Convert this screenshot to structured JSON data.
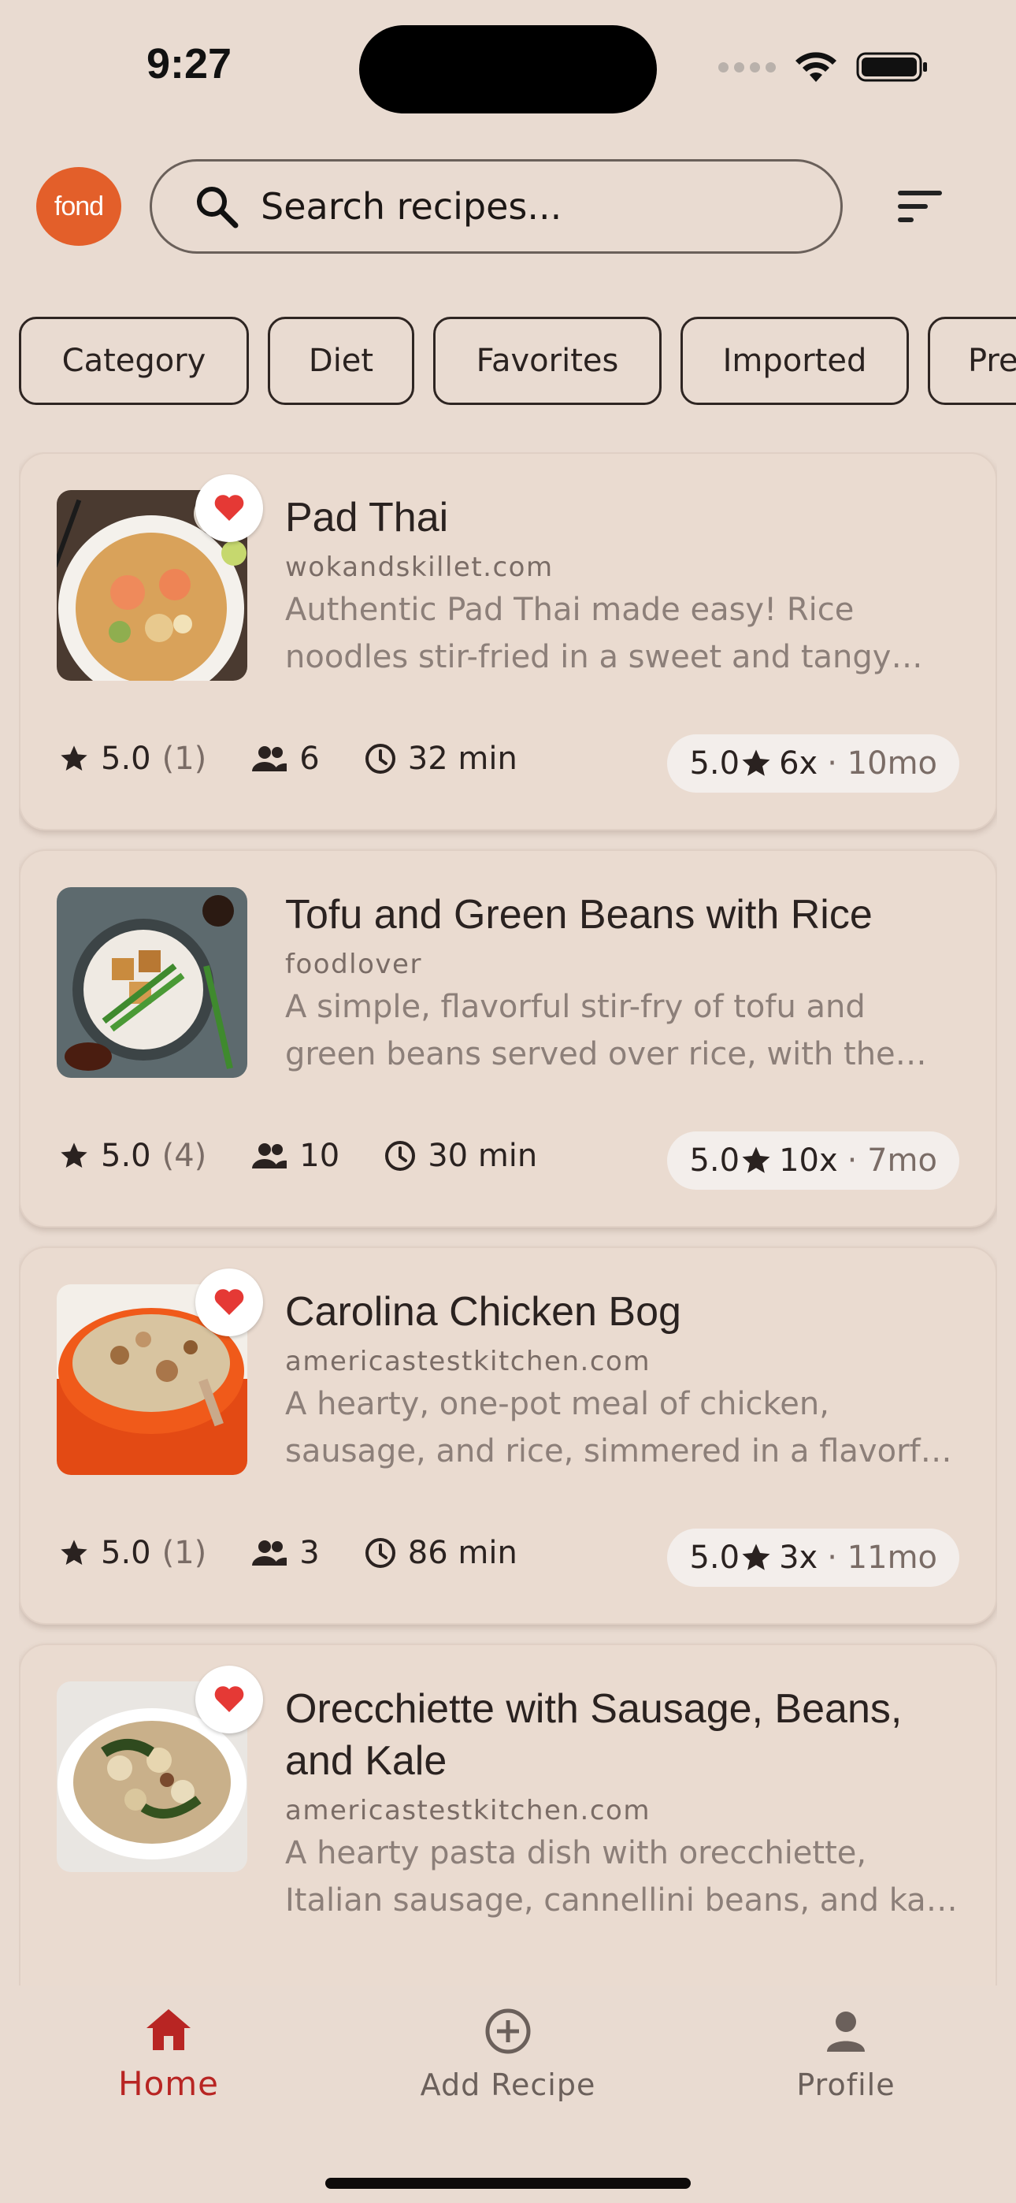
{
  "status_bar": {
    "time": "9:27"
  },
  "header": {
    "logo_text": "fond",
    "search_placeholder": "Search recipes..."
  },
  "filters": [
    "Category",
    "Diet",
    "Favorites",
    "Imported",
    "Pre"
  ],
  "recipes": [
    {
      "title": "Pad Thai",
      "source": "wokandskillet.com",
      "description": "Authentic Pad Thai made easy! Rice noodles stir-fried in a sweet and tangy sauce with shrimp, tofu, peanuts and bean sprouts.",
      "favorite": true,
      "rating": "5.0",
      "rating_count": "(1)",
      "servings": "6",
      "time": "32 min",
      "stat_rating": "5.0",
      "stat_count": "6x",
      "stat_age": "· 10mo"
    },
    {
      "title": "Tofu and Green Beans with Rice",
      "source": "foodlover",
      "description": "A simple, flavorful stir-fry of tofu and green beans served over rice, with the option to add a savory sauce.",
      "favorite": false,
      "rating": "5.0",
      "rating_count": "(4)",
      "servings": "10",
      "time": "30 min",
      "stat_rating": "5.0",
      "stat_count": "10x",
      "stat_age": "· 7mo"
    },
    {
      "title": "Carolina Chicken Bog",
      "source": "americastestkitchen.com",
      "description": "A hearty, one-pot meal of chicken, sausage, and rice, simmered in a flavorful broth until tender.",
      "favorite": true,
      "rating": "5.0",
      "rating_count": "(1)",
      "servings": "3",
      "time": "86 min",
      "stat_rating": "5.0",
      "stat_count": "3x",
      "stat_age": "· 11mo"
    },
    {
      "title": "Orecchiette with Sausage, Beans, and Kale",
      "source": "americastestkitchen.com",
      "description": "A hearty pasta dish with orecchiette, Italian sausage, cannellini beans, and kale tossed with garlic and parmesan.",
      "favorite": true
    }
  ],
  "bottom_nav": {
    "home": "Home",
    "add": "Add Recipe",
    "profile": "Profile"
  },
  "colors": {
    "background": "#e9dbd1",
    "accent_red": "#b82523",
    "heart": "#e53935",
    "logo": "#e35f2a"
  }
}
